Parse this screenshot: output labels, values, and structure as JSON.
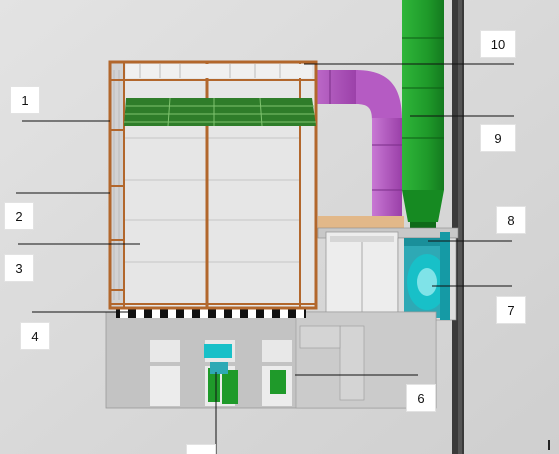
{
  "callouts": [
    "1",
    "2",
    "3",
    "4",
    "6",
    "7",
    "8",
    "9",
    "10"
  ],
  "colors": {
    "background": "#d9d9d9",
    "frame": "#b2672c",
    "panel": "#e4e4e4",
    "grid_top": "#2f7d2a",
    "duct": "#b657c4",
    "stack": "#1f9a2a",
    "fan": "#18c0c8",
    "base": "#bdbdbd"
  }
}
